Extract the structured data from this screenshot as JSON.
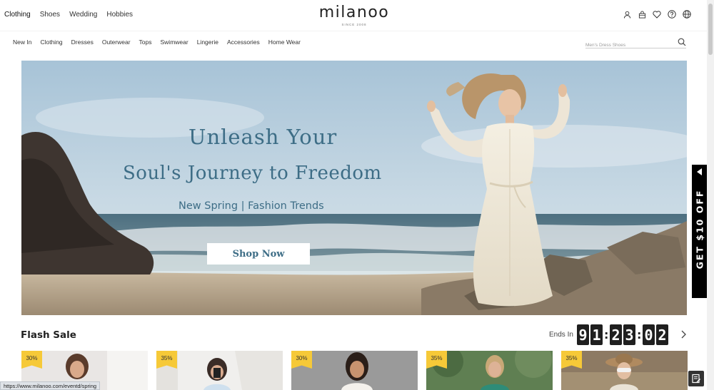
{
  "header": {
    "category_tabs": [
      "Clothing",
      "Shoes",
      "Wedding",
      "Hobbies"
    ],
    "logo_text": "milanoo",
    "logo_tagline": "SINCE 2008",
    "icons": [
      "user-icon",
      "bag-icon",
      "heart-icon",
      "help-icon",
      "globe-icon"
    ]
  },
  "nav": {
    "links": [
      "New In",
      "Clothing",
      "Dresses",
      "Outerwear",
      "Tops",
      "Swimwear",
      "Lingerie",
      "Accessories",
      "Home Wear"
    ],
    "search_placeholder": "Men's Dress Shoes"
  },
  "hero": {
    "headline_line1": "Unleash Your",
    "headline_line2": "Soul's Journey to Freedom",
    "subheadline": "New Spring | Fashion Trends",
    "cta_label": "Shop Now"
  },
  "promo_tab": {
    "label": "GET $10 OFF"
  },
  "flash_sale": {
    "title": "Flash Sale",
    "ends_in_label": "Ends In",
    "countdown_digits": [
      "9",
      "1",
      "2",
      "3",
      "0",
      "2"
    ],
    "products": [
      {
        "discount": "30%"
      },
      {
        "discount": "35%"
      },
      {
        "discount": "30%"
      },
      {
        "discount": "35%"
      },
      {
        "discount": "35%"
      }
    ]
  },
  "status_bar": {
    "url": "https://www.milanoo.com/eventd/spring"
  },
  "colors": {
    "hero_text": "#3d6d86",
    "badge": "#f6c938",
    "countdown_bg": "#1f1f1f",
    "promo_bg": "#000000"
  }
}
